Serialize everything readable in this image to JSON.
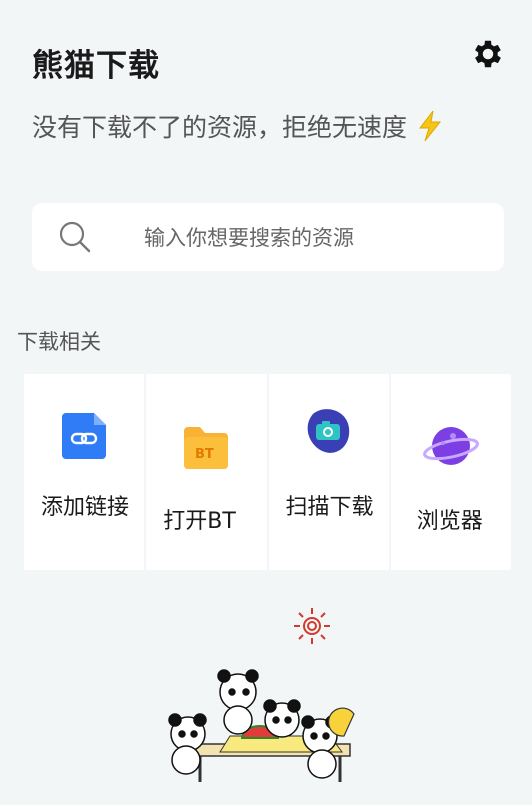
{
  "header": {
    "app_title": "熊猫下载",
    "settings_icon": "gear-icon"
  },
  "slogan": {
    "text": "没有下载不了的资源，拒绝无速度",
    "icon": "lightning-bolt-icon",
    "icon_color": "#f5c518"
  },
  "search": {
    "placeholder": "输入你想要搜索的资源"
  },
  "section": {
    "title": "下载相关"
  },
  "actions": [
    {
      "label": "添加链接",
      "icon": "link-file-icon",
      "color": "#2f7cf6"
    },
    {
      "label": "打开BT",
      "icon": "bt-folder-icon",
      "color": "#f9b233"
    },
    {
      "label": "扫描下载",
      "icon": "camera-scan-icon",
      "color": "#3b3fb6"
    },
    {
      "label": "浏览器",
      "icon": "planet-browser-icon",
      "color": "#7b3fe4"
    }
  ],
  "illustration": {
    "icon": "pandas-picnic-illustration"
  }
}
